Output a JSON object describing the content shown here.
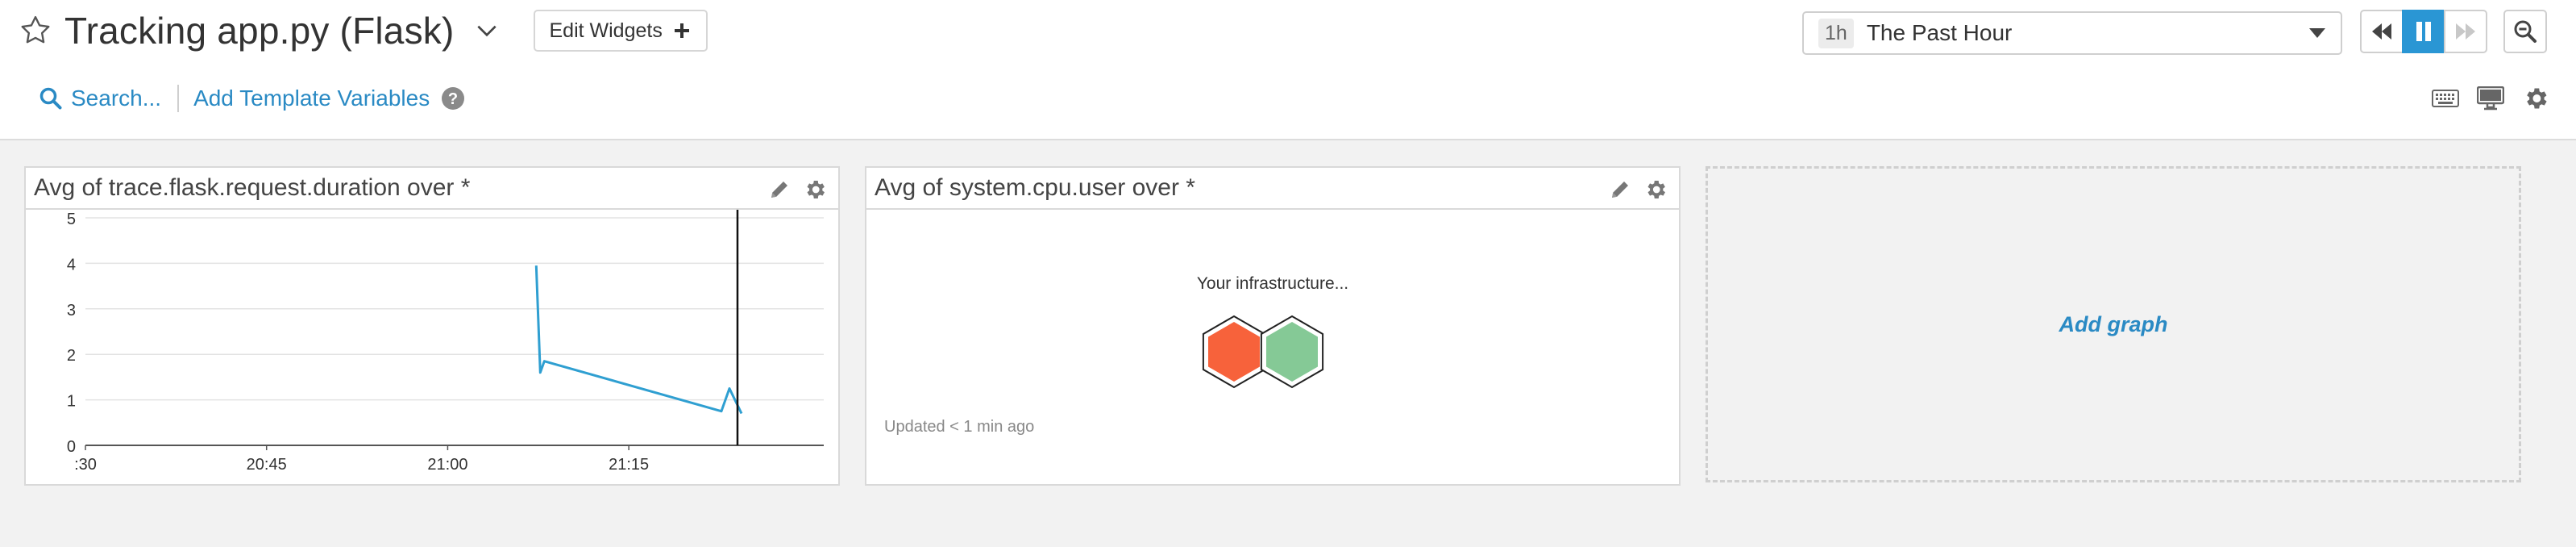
{
  "header": {
    "title": "Tracking app.py (Flask)",
    "edit_widgets_label": "Edit Widgets",
    "search_label": "Search...",
    "template_vars_label": "Add Template Variables"
  },
  "timeframe": {
    "badge": "1h",
    "label": "The Past Hour"
  },
  "colors": {
    "accent": "#2a8ac4",
    "active_button": "#2a96d4",
    "series_line": "#2f9fd1",
    "hex_red": "#f7623b",
    "hex_green": "#85c996"
  },
  "widgets": {
    "timeseries": {
      "title": "Avg of trace.flask.request.duration over *"
    },
    "hostmap": {
      "title": "Avg of system.cpu.user over *",
      "caption": "Your infrastructure...",
      "updated": "Updated < 1 min ago",
      "hexes": [
        {
          "status": "high",
          "color": "#f7623b"
        },
        {
          "status": "ok",
          "color": "#85c996"
        }
      ]
    },
    "add_graph_label": "Add graph"
  },
  "chart_data": {
    "type": "line",
    "title": "Avg of trace.flask.request.duration over *",
    "xlabel": "",
    "ylabel": "",
    "x_ticks": [
      ":30",
      "20:45",
      "21:00",
      "21:15"
    ],
    "y_ticks": [
      "0",
      "1",
      "2",
      "3",
      "4",
      "5"
    ],
    "ylim": [
      0,
      5
    ],
    "grid": true,
    "series": [
      {
        "points": [
          {
            "x": "21:07:20",
            "y": 3.95
          },
          {
            "x": "21:07:40",
            "y": 1.6
          },
          {
            "x": "21:08:00",
            "y": 1.85
          },
          {
            "x": "21:22:40",
            "y": 0.75
          },
          {
            "x": "21:23:20",
            "y": 1.25
          },
          {
            "x": "21:24:20",
            "y": 0.7
          }
        ]
      }
    ],
    "cursor_time": "21:24"
  }
}
